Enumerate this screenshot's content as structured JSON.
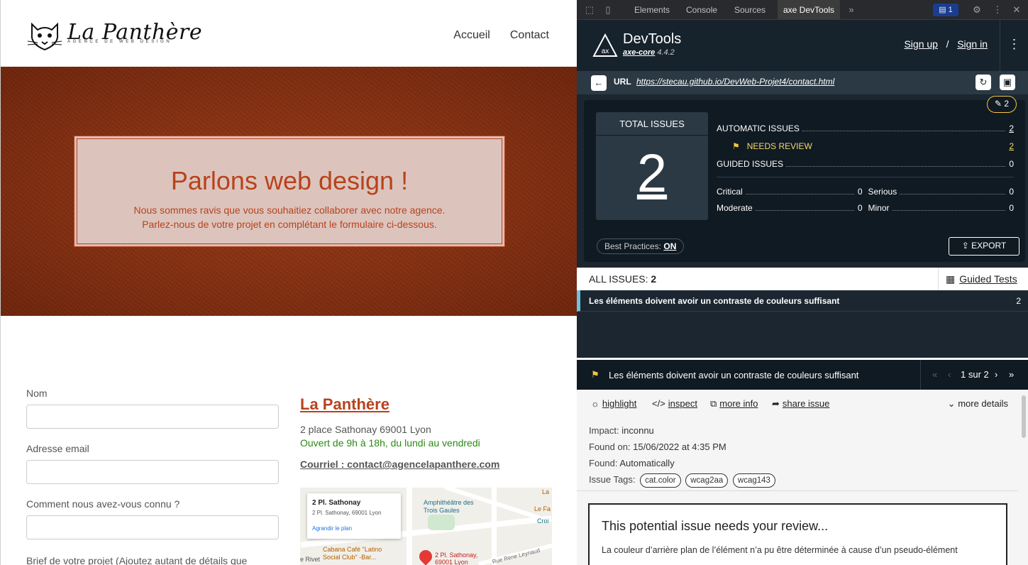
{
  "site": {
    "logo_text": "La Panthère",
    "logo_sub": "AGENCE DE WEB DESIGN",
    "nav": [
      "Accueil",
      "Contact"
    ],
    "hero_title": "Parlons web design !",
    "hero_line1": "Nous sommes ravis que vous souhaitiez collaborer avec notre agence.",
    "hero_line2": "Parlez-nous de votre projet en complétant le formulaire ci-dessous.",
    "form": {
      "name_label": "Nom",
      "email_label": "Adresse email",
      "source_label": "Comment nous avez-vous connu ?",
      "brief_label": "Brief de votre projet (Ajoutez autant de détails que nécessaire)"
    },
    "contact": {
      "name": "La Panthère",
      "address": "2 place Sathonay 69001 Lyon",
      "hours": "Ouvert de 9h à 18h, du lundi au vendredi",
      "email": "Courriel : contact@agencelapanthere.com"
    },
    "map": {
      "card_title": "2 Pl. Sathonay",
      "card_addr": "2 Pl. Sathonay, 69001 Lyon",
      "card_link": "Agrandir le plan",
      "label_amphi": "Amphithéâtre des Trois Gaules",
      "label_cabana": "Cabana Café \"Latino Social Club\" -Bar...",
      "label_pin": "2 Pl. Sathonay, 69001 Lyon",
      "label_rue": "Rue Rene Leynaud",
      "label_rivet": "e Rivet",
      "label_la": "La",
      "label_lefa": "Le Fa",
      "label_croi": "Croi"
    }
  },
  "devtools": {
    "tabs": [
      "Elements",
      "Console",
      "Sources",
      "axe DevTools"
    ],
    "active_tab": "axe DevTools",
    "badge": "1",
    "axe": {
      "title": "DevTools",
      "core_name": "axe-core",
      "core_version": "4.4.2",
      "sign_up": "Sign up",
      "slash": "/",
      "sign_in": "Sign in",
      "url_label": "URL",
      "url": "https://stecau.github.io/DevWeb-Projet4/contact.html",
      "pencil_count": "2",
      "total_label": "TOTAL ISSUES",
      "total_value": "2",
      "automatic_label": "AUTOMATIC ISSUES",
      "automatic_value": "2",
      "needs_review_label": "NEEDS REVIEW",
      "needs_review_value": "2",
      "guided_label": "GUIDED ISSUES",
      "guided_value": "0",
      "critical_label": "Critical",
      "critical_value": "0",
      "serious_label": "Serious",
      "serious_value": "0",
      "moderate_label": "Moderate",
      "moderate_value": "0",
      "minor_label": "Minor",
      "minor_value": "0",
      "best_practices_label": "Best Practices:",
      "best_practices_value": "ON",
      "export_label": "EXPORT",
      "all_issues_label": "ALL ISSUES:",
      "all_issues_value": "2",
      "guided_tests": "Guided Tests",
      "issue_title": "Les éléments doivent avoir un contraste de couleurs suffisant",
      "issue_count": "2",
      "detail_title": "Les éléments doivent avoir un contraste de couleurs suffisant",
      "pager": "1 sur 2",
      "actions": [
        "highlight",
        "inspect",
        "more info",
        "share issue"
      ],
      "more_details": "more details",
      "impact_label": "Impact:",
      "impact_value": "inconnu",
      "found_on_label": "Found on:",
      "found_on_value": "15/06/2022 at 4:35 PM",
      "found_label": "Found:",
      "found_value": "Automatically",
      "tags_label": "Issue Tags:",
      "tags": [
        "cat.color",
        "wcag2aa",
        "wcag143"
      ],
      "review_heading": "This potential issue needs your review...",
      "review_text": "La couleur d’arrière plan de l’élément n’a pu être déterminée à cause d’un pseudo-élément"
    }
  },
  "colors": {
    "accent": "#b8421c",
    "hours_green": "#2a8a14",
    "axe_dark": "#16222c",
    "needs_review": "#f5c542",
    "issue_marker": "#6fc3df"
  }
}
